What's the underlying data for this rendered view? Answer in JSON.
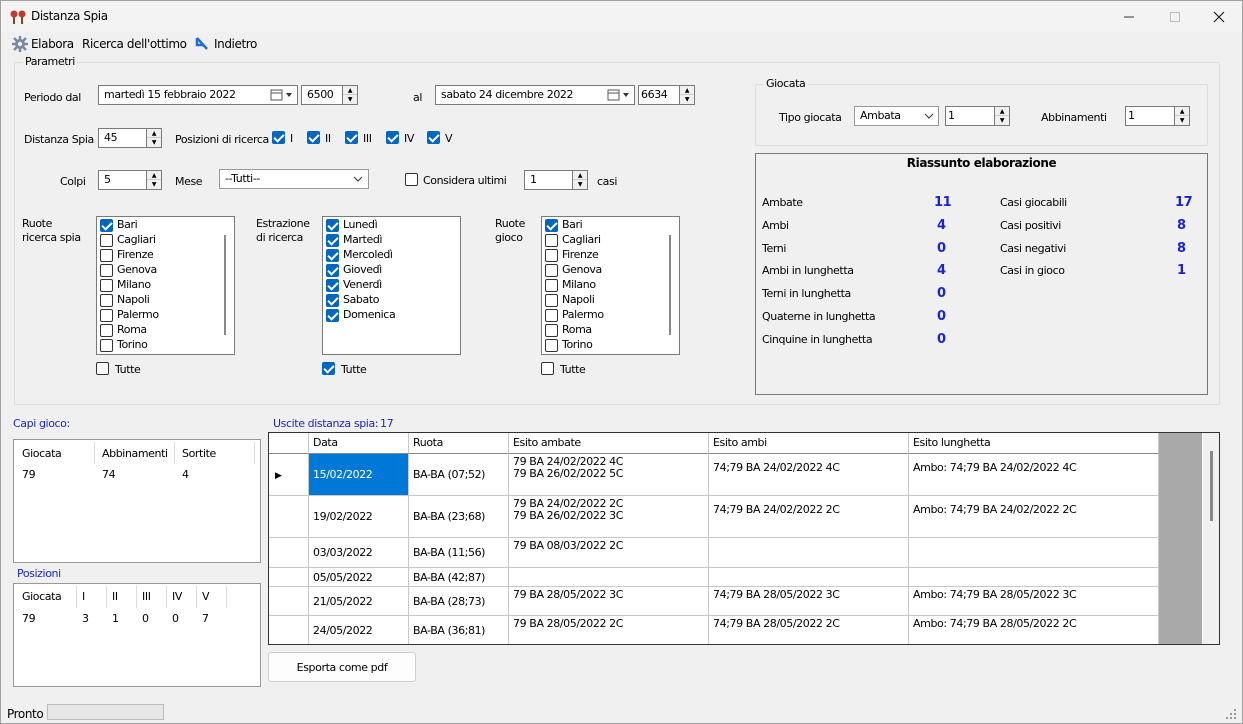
{
  "window": {
    "title": "Distanza Spia"
  },
  "toolbar": {
    "elabora": "Elabora",
    "ricerca": "Ricerca dell'ottimo",
    "indietro": "Indietro"
  },
  "parametri": {
    "group_title": "Parametri",
    "periodo_label": "Periodo dal",
    "date_from": "martedì   15  febbraio  2022",
    "num_from": "6500",
    "al_label": "al",
    "date_to": "sabato    24  dicembre  2022",
    "num_to": "6634",
    "distanza_label": "Distanza Spia",
    "distanza_value": "45",
    "posizioni_label": "Posizioni di ricerca",
    "posizioni": [
      {
        "label": "I",
        "checked": true
      },
      {
        "label": "II",
        "checked": true
      },
      {
        "label": "III",
        "checked": true
      },
      {
        "label": "IV",
        "checked": true
      },
      {
        "label": "V",
        "checked": true
      }
    ],
    "colpi_label": "Colpi",
    "colpi_value": "5",
    "mese_label": "Mese",
    "mese_value": "--Tutti--",
    "considera_label": "Considera ultimi",
    "considera_value": "1",
    "casi_label": "casi",
    "ruote_spia_label_1": "Ruote",
    "ruote_spia_label_2": "ricerca spia",
    "ruote_spia": [
      {
        "label": "Bari",
        "checked": true
      },
      {
        "label": "Cagliari",
        "checked": false
      },
      {
        "label": "Firenze",
        "checked": false
      },
      {
        "label": "Genova",
        "checked": false
      },
      {
        "label": "Milano",
        "checked": false
      },
      {
        "label": "Napoli",
        "checked": false
      },
      {
        "label": "Palermo",
        "checked": false
      },
      {
        "label": "Roma",
        "checked": false
      },
      {
        "label": "Torino",
        "checked": false
      }
    ],
    "tutte_1": "Tutte",
    "estrazione_label_1": "Estrazione",
    "estrazione_label_2": "di ricerca",
    "estrazioni": [
      {
        "label": "Lunedì",
        "checked": true
      },
      {
        "label": "Martedì",
        "checked": true
      },
      {
        "label": "Mercoledì",
        "checked": true
      },
      {
        "label": "Giovedì",
        "checked": true
      },
      {
        "label": "Venerdì",
        "checked": true
      },
      {
        "label": "Sabato",
        "checked": true
      },
      {
        "label": "Domenica",
        "checked": true
      }
    ],
    "tutte_2": "Tutte",
    "ruote_gioco_label_1": "Ruote",
    "ruote_gioco_label_2": "gioco",
    "ruote_gioco": [
      {
        "label": "Bari",
        "checked": true
      },
      {
        "label": "Cagliari",
        "checked": false
      },
      {
        "label": "Firenze",
        "checked": false
      },
      {
        "label": "Genova",
        "checked": false
      },
      {
        "label": "Milano",
        "checked": false
      },
      {
        "label": "Napoli",
        "checked": false
      },
      {
        "label": "Palermo",
        "checked": false
      },
      {
        "label": "Roma",
        "checked": false
      },
      {
        "label": "Torino",
        "checked": false
      }
    ],
    "tutte_3": "Tutte"
  },
  "giocata": {
    "group_title": "Giocata",
    "tipo_label": "Tipo giocata",
    "tipo_value": "Ambata",
    "tipo_num": "1",
    "abbinamenti_label": "Abbinamenti",
    "abbinamenti_value": "1"
  },
  "riassunto": {
    "title": "Riassunto elaborazione",
    "left": [
      {
        "label": "Ambate",
        "value": "11"
      },
      {
        "label": "Ambi",
        "value": "4"
      },
      {
        "label": "Terni",
        "value": "0"
      },
      {
        "label": "Ambi in lunghetta",
        "value": "4"
      },
      {
        "label": "Terni in lunghetta",
        "value": "0"
      },
      {
        "label": "Quaterne in lunghetta",
        "value": "0"
      },
      {
        "label": "Cinquine in lunghetta",
        "value": "0"
      }
    ],
    "right": [
      {
        "label": "Casi giocabili",
        "value": "17"
      },
      {
        "label": "Casi positivi",
        "value": "8"
      },
      {
        "label": "Casi negativi",
        "value": "8"
      },
      {
        "label": "Casi in gioco",
        "value": "1"
      }
    ]
  },
  "capi": {
    "label": "Capi gioco:",
    "headers": [
      "Giocata",
      "Abbinamenti",
      "Sortite"
    ],
    "row": [
      "79",
      "74",
      "4"
    ]
  },
  "posizioni_grid": {
    "label": "Posizioni",
    "headers": [
      "Giocata",
      "I",
      "II",
      "III",
      "IV",
      "V"
    ],
    "row": [
      "79",
      "3",
      "1",
      "0",
      "0",
      "7"
    ]
  },
  "uscite": {
    "label": "Uscite distanza spia:",
    "count": "17",
    "headers": [
      "Data",
      "Ruota",
      "Esito ambate",
      "Esito ambi",
      "Esito lunghetta"
    ],
    "rows": [
      {
        "data": "15/02/2022",
        "ruota": "BA-BA (07;52)",
        "ambate": [
          "79 BA  24/02/2022  4C",
          "79 BA  26/02/2022  5C"
        ],
        "ambi": "74;79 BA  24/02/2022  4C",
        "lunghetta": "Ambo: 74;79 BA  24/02/2022  4C"
      },
      {
        "data": "19/02/2022",
        "ruota": "BA-BA (23;68)",
        "ambate": [
          "79 BA  24/02/2022  2C",
          "79 BA  26/02/2022  3C"
        ],
        "ambi": "74;79 BA  24/02/2022  2C",
        "lunghetta": "Ambo: 74;79 BA  24/02/2022  2C"
      },
      {
        "data": "03/03/2022",
        "ruota": "BA-BA (11;56)",
        "ambate": [
          "79 BA  08/03/2022  2C"
        ],
        "ambi": "",
        "lunghetta": ""
      },
      {
        "data": "05/05/2022",
        "ruota": "BA-BA (42;87)",
        "ambate": [],
        "ambi": "",
        "lunghetta": ""
      },
      {
        "data": "21/05/2022",
        "ruota": "BA-BA (28;73)",
        "ambate": [
          "79 BA  28/05/2022  3C"
        ],
        "ambi": "74;79 BA  28/05/2022  3C",
        "lunghetta": "Ambo: 74;79 BA  28/05/2022  3C"
      },
      {
        "data": "24/05/2022",
        "ruota": "BA-BA (36;81)",
        "ambate": [
          "79 BA  28/05/2022  2C"
        ],
        "ambi": "74;79 BA  28/05/2022  2C",
        "lunghetta": "Ambo: 74;79 BA  28/05/2022  2C"
      }
    ]
  },
  "export_button": "Esporta come pdf",
  "status": {
    "text": "Pronto"
  }
}
